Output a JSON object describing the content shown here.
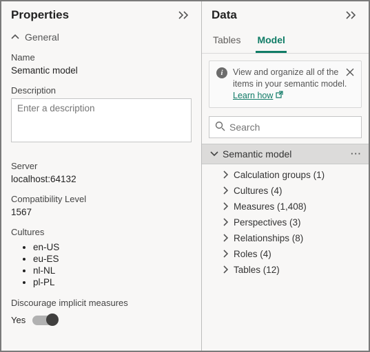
{
  "left": {
    "title": "Properties",
    "general": {
      "header": "General",
      "name_label": "Name",
      "name_value": "Semantic model",
      "description_label": "Description",
      "description_placeholder": "Enter a description",
      "server_label": "Server",
      "server_value": "localhost:64132",
      "compat_label": "Compatibility Level",
      "compat_value": "1567",
      "cultures_label": "Cultures",
      "cultures": [
        "en-US",
        "eu-ES",
        "nl-NL",
        "pl-PL"
      ],
      "discourage_label": "Discourage implicit measures",
      "discourage_value": "Yes"
    }
  },
  "right": {
    "title": "Data",
    "tabs": {
      "tables": "Tables",
      "model": "Model"
    },
    "info": {
      "text": "View and organize all of the items in your semantic model.",
      "learn": "Learn how"
    },
    "search_placeholder": "Search",
    "root_label": "Semantic model",
    "items": [
      {
        "label": "Calculation groups (1)"
      },
      {
        "label": "Cultures (4)"
      },
      {
        "label": "Measures (1,408)"
      },
      {
        "label": "Perspectives (3)"
      },
      {
        "label": "Relationships (8)"
      },
      {
        "label": "Roles (4)"
      },
      {
        "label": "Tables (12)"
      }
    ]
  }
}
